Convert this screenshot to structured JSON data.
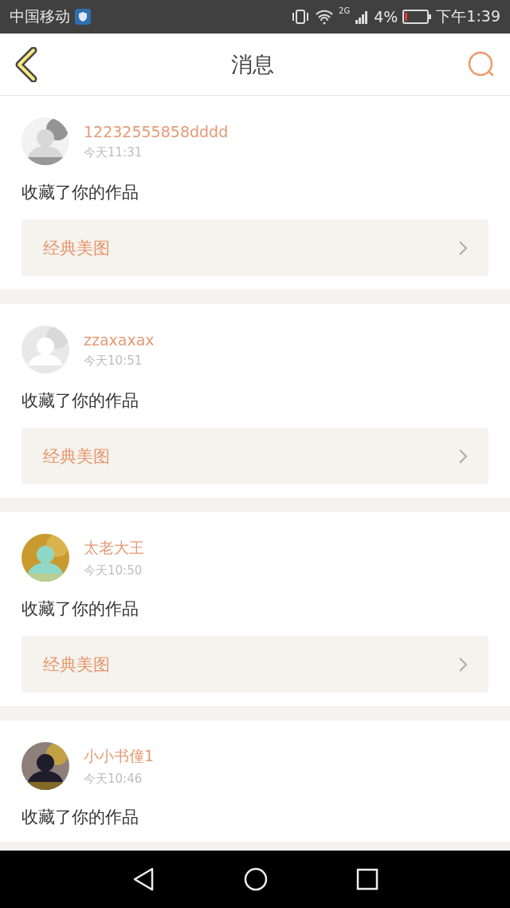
{
  "status_bar": {
    "carrier": "中国移动",
    "network": "2G",
    "battery": "4%",
    "time": "下午1:39"
  },
  "header": {
    "title": "消息"
  },
  "messages": [
    {
      "user": "12232555858dddd",
      "time": "今天11:31",
      "action": "收藏了你的作品",
      "work": {
        "title": "经典美图"
      }
    },
    {
      "user": "zzaxaxax",
      "time": "今天10:51",
      "action": "收藏了你的作品",
      "work": {
        "title": "经典美图"
      }
    },
    {
      "user": "太老大王",
      "time": "今天10:50",
      "action": "收藏了你的作品",
      "work": {
        "title": "经典美图"
      }
    },
    {
      "user": "小小书僮1",
      "time": "今天10:46",
      "action": "收藏了你的作品"
    }
  ]
}
